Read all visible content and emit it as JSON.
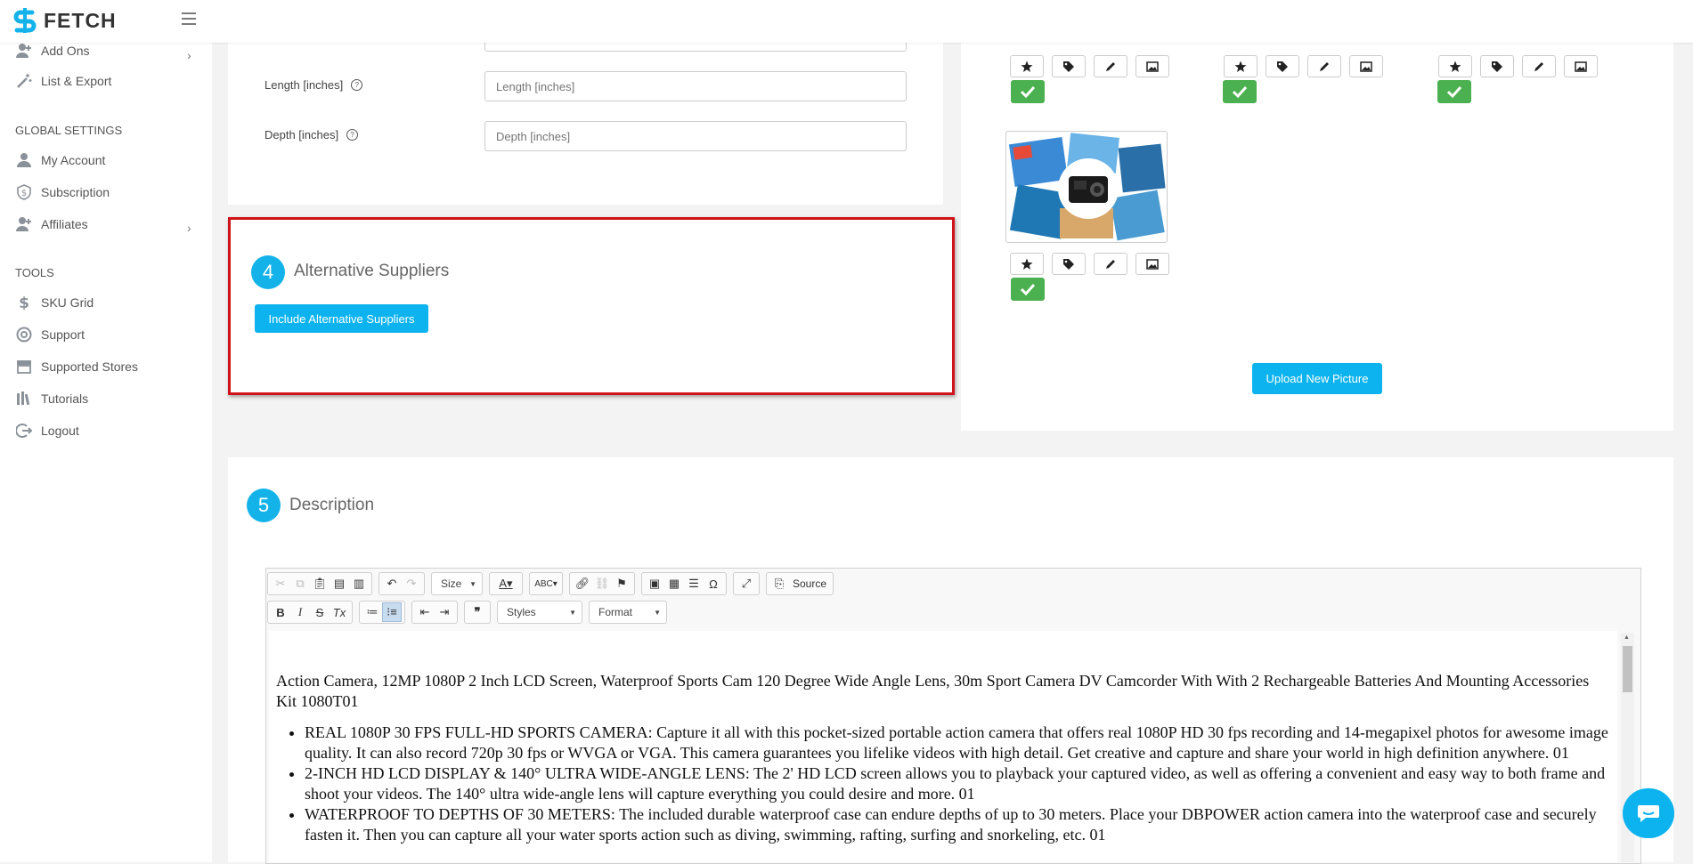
{
  "app": {
    "name": "FETCH"
  },
  "sidebar": {
    "items": [
      {
        "label": "Add Ons",
        "icon": "user-plus-icon"
      },
      {
        "label": "List & Export",
        "icon": "wand-icon"
      },
      {
        "label": "My Account",
        "icon": "user-icon"
      },
      {
        "label": "Subscription",
        "icon": "dollar-shield-icon"
      },
      {
        "label": "Affiliates",
        "icon": "user-plus-icon"
      },
      {
        "label": "SKU Grid",
        "icon": "dollar-icon"
      },
      {
        "label": "Support",
        "icon": "lifebuoy-icon"
      },
      {
        "label": "Supported Stores",
        "icon": "store-icon"
      },
      {
        "label": "Tutorials",
        "icon": "books-icon"
      },
      {
        "label": "Logout",
        "icon": "logout-icon"
      }
    ],
    "headings": {
      "global_settings": "GLOBAL SETTINGS",
      "tools": "TOOLS"
    }
  },
  "dimensions": {
    "length_label": "Length [inches]",
    "length_placeholder": "Length [inches]",
    "depth_label": "Depth [inches]",
    "depth_placeholder": "Depth [inches]",
    "help_glyph": "?"
  },
  "alt_suppliers": {
    "number": "4",
    "title": "Alternative Suppliers",
    "button": "Include Alternative Suppliers"
  },
  "pictures": {
    "upload_button": "Upload New Picture",
    "action_icons": [
      "star-icon",
      "tag-icon",
      "pencil-icon",
      "image-icon"
    ]
  },
  "description": {
    "number": "5",
    "title": "Description",
    "toolbar": {
      "size_label": "Size",
      "styles_label": "Styles",
      "format_label": "Format",
      "source_label": "Source"
    },
    "content": {
      "heading": "Action Camera, 12MP 1080P 2 Inch LCD Screen, Waterproof Sports Cam 120 Degree Wide Angle Lens, 30m Sport Camera DV Camcorder With With 2 Rechargeable Batteries And Mounting Accessories Kit 1080T01",
      "bullets": [
        "REAL 1080P 30 FPS FULL-HD SPORTS CAMERA: Capture it all with this pocket-sized portable action camera that offers real 1080P HD 30 fps recording and 14-megapixel photos for awesome image quality. It can also record 720p 30 fps or WVGA or VGA. This camera guarantees you lifelike videos with high detail. Get creative and capture and share your world in high definition anywhere. 01",
        "2-INCH HD LCD DISPLAY & 140° ULTRA WIDE-ANGLE LENS: The 2' HD LCD screen allows you to playback your captured video, as well as offering a convenient and easy way to both frame and shoot your videos. The 140° ultra wide-angle lens will capture everything you could desire and more. 01",
        "WATERPROOF TO DEPTHS OF 30 METERS: The included durable waterproof case can endure depths of up to 30 meters. Place your DBPOWER action camera into the waterproof case and securely fasten it. Then you can capture all your water sports action such as diving, swimming, rafting, surfing and snorkeling, etc. 01"
      ]
    }
  },
  "colors": {
    "accent": "#0cb3ee",
    "success": "#4bb04f",
    "highlight": "#d0131b"
  }
}
